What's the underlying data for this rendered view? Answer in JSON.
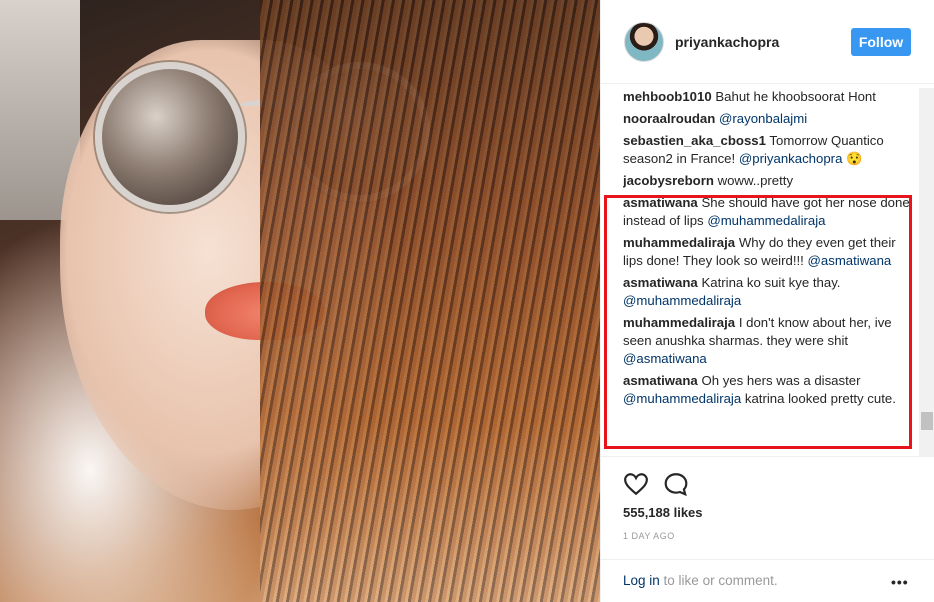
{
  "post": {
    "username": "priyankachopra",
    "follow_label": "Follow"
  },
  "comments": [
    {
      "author": "mehboob1010",
      "text": "Bahut he khoobsoorat Hont",
      "mention": ""
    },
    {
      "author": "nooraalroudan",
      "text": "",
      "mention": "@rayonbalajmi"
    },
    {
      "author": "sebastien_aka_cboss1",
      "text": "Tomorrow Quantico season2 in France!",
      "mention": "@priyankachopra",
      "suffix": "😯"
    },
    {
      "author": "jacobysreborn",
      "text": "woww..pretty",
      "mention": ""
    },
    {
      "author": "asmatiwana",
      "text": "She should have got her nose done instead of lips",
      "mention": "@muhammedaliraja"
    },
    {
      "author": "muhammedaliraja",
      "text": "Why do they even get their lips done! They look so weird!!!",
      "mention": "@asmatiwana"
    },
    {
      "author": "asmatiwana",
      "text": "Katrina ko suit kye thay.",
      "mention": "@muhammedaliraja"
    },
    {
      "author": "muhammedaliraja",
      "text": "I don't know about her, ive seen anushka sharmas. they were shit",
      "mention": "@asmatiwana"
    },
    {
      "author": "asmatiwana",
      "text": "Oh yes hers was a disaster",
      "mention": "@muhammedaliraja",
      "suffix": "katrina looked pretty cute."
    }
  ],
  "footer": {
    "likes": "555,188 likes",
    "time": "1 DAY AGO",
    "login_link": "Log in",
    "login_rest": " to like or comment.",
    "more": "•••"
  },
  "icons": {
    "like": "heart-icon",
    "comment": "speech-bubble-icon",
    "more": "more-options-icon"
  },
  "colors": {
    "follow_button": "#3897f0",
    "mention": "#003569",
    "highlight_box": "#e8141b"
  }
}
